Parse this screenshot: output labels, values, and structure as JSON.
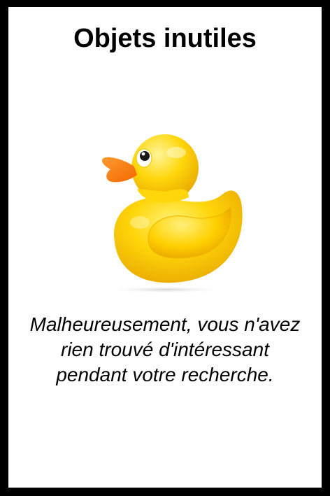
{
  "card": {
    "title": "Objets inutiles",
    "description": "Malheureusement, vous n'avez rien trouvé d'intéressant pendant votre recherche.",
    "illustration": "rubber-duck-icon"
  },
  "colors": {
    "frame": "#000000",
    "background": "#ffffff",
    "duck_body": "#ffd60a",
    "duck_shade": "#f0b400",
    "beak": "#ff7a00",
    "text": "#000000"
  }
}
